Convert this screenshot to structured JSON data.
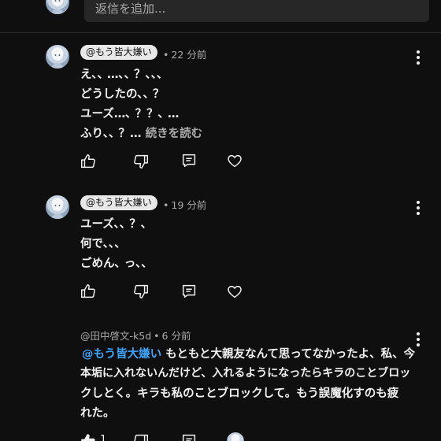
{
  "reply_placeholder": "返信を追加...",
  "comments": [
    {
      "author": "@もう皆大嫌い",
      "time": "22 分前",
      "lines": [
        "え､､ …､､ ？､､､",
        "どうしたの､､ ？",
        "ユーズ…､ ？？､ …",
        "ふり､､ ？…"
      ],
      "read_more": "続きを読む"
    },
    {
      "author": "@もう皆大嫌い",
      "time": "19 分前",
      "lines": [
        "ユーズ､､ ？､",
        "何で､､､",
        "ごめん､ っ､､"
      ]
    },
    {
      "author": "@田中啓文-k5d",
      "time": "6 分前",
      "mention": "@もう皆大嫌い",
      "lines": [
        "もともと大親友なんて思ってなかったよ、私、今",
        "本垢に入れないんだけど、入れるようになったらキラのことブロッ",
        "クしとく。キラも私のことブロックして。もう誤魔化すのも疲",
        "れた。"
      ],
      "like_count": "1"
    }
  ],
  "separator": "•",
  "icons": {
    "like": "thumbs-up-icon",
    "dislike": "thumbs-down-icon",
    "reply": "reply-icon",
    "heart": "heart-icon",
    "more": "more-vertical-icon"
  },
  "colors": {
    "background": "#0f0f0f",
    "mention": "#3ea6ff",
    "chip": "#e8e8e8"
  }
}
